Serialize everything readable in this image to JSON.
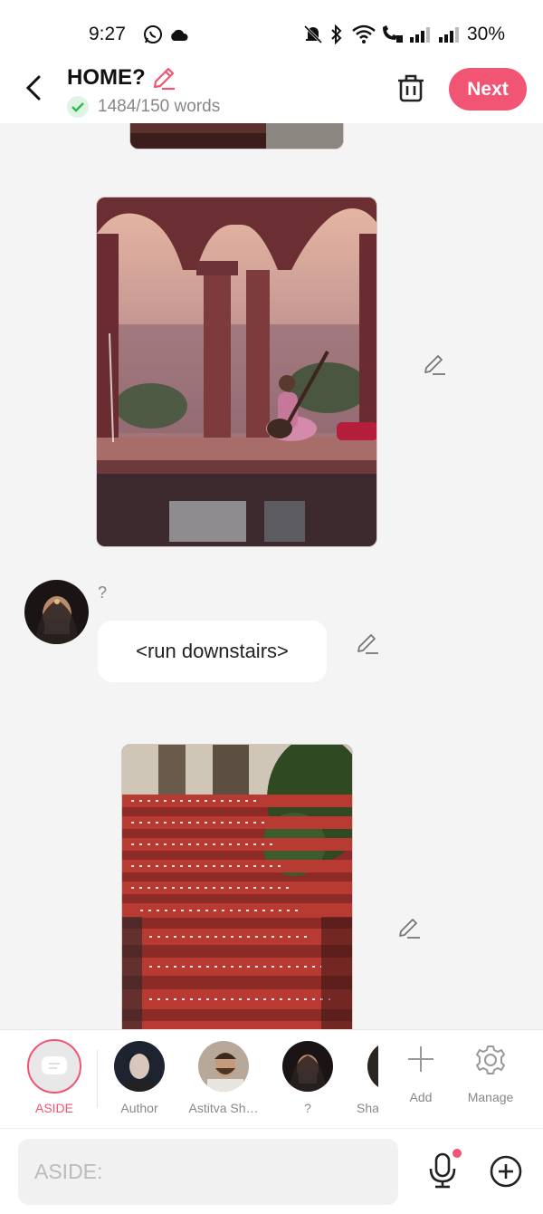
{
  "status_bar": {
    "time": "9:27",
    "battery": "30%"
  },
  "header": {
    "title": "HOME?",
    "words": "1484/150 words",
    "next_label": "Next"
  },
  "feed": {
    "speaker_name": "?",
    "message": "<run downstairs>"
  },
  "characters": [
    {
      "label": "ASIDE"
    },
    {
      "label": "Author"
    },
    {
      "label": "Astitva Sh…"
    },
    {
      "label": "?"
    },
    {
      "label": "Sha"
    },
    {
      "label": "Add"
    },
    {
      "label": "Manage"
    }
  ],
  "input": {
    "placeholder": "ASIDE:"
  },
  "colors": {
    "accent": "#f25473",
    "check_green": "#2fb84f"
  }
}
